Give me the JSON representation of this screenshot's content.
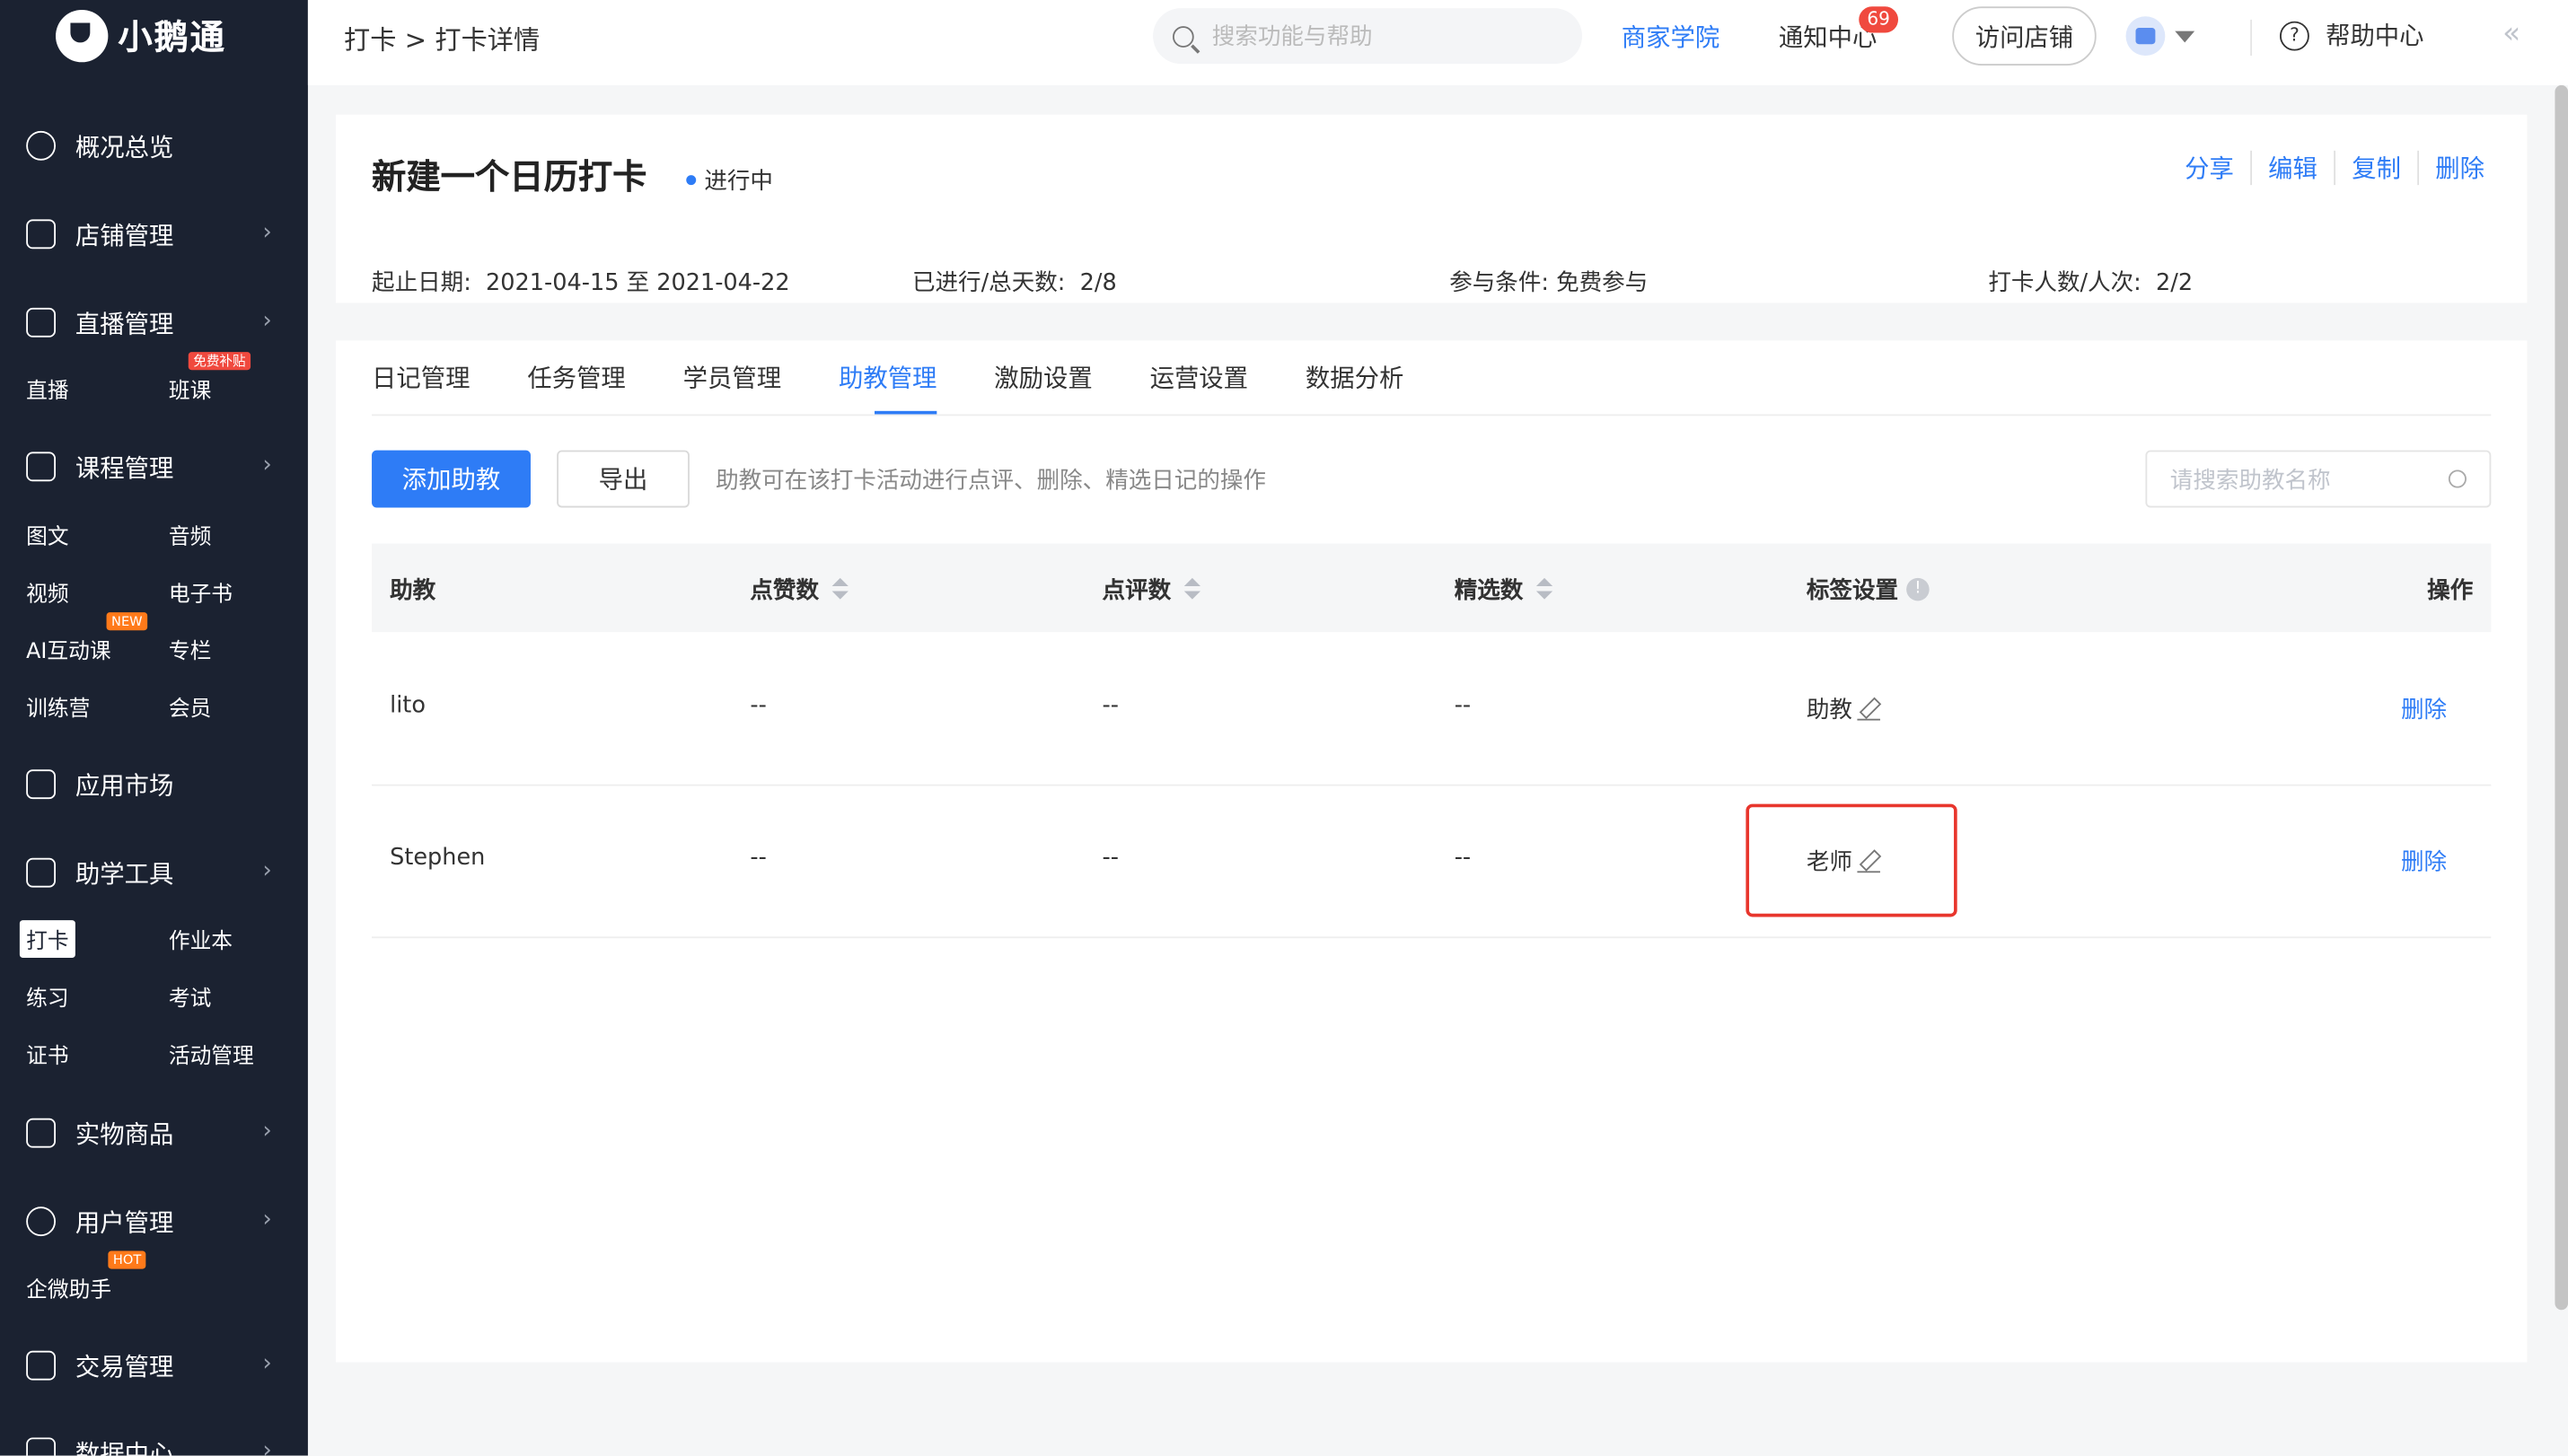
{
  "sidebar": {
    "logo": "小鹅通",
    "sections": {
      "overview": "概况总览",
      "store": "店铺管理",
      "live": "直播管理",
      "course": "课程管理",
      "market": "应用市场",
      "tools": "助学工具",
      "goods": "实物商品",
      "users": "用户管理",
      "trade": "交易管理",
      "data": "数据中心"
    },
    "live_items": [
      "直播",
      "班课"
    ],
    "course_items": [
      "图文",
      "音频",
      "视频",
      "电子书",
      "AI互动课",
      "专栏",
      "训练营",
      "会员"
    ],
    "tools_items": [
      "打卡",
      "作业本",
      "练习",
      "考试",
      "证书",
      "活动管理"
    ],
    "user_items": [
      "企微助手"
    ],
    "tags": {
      "free": "免费补贴",
      "new": "NEW",
      "hot": "HOT"
    }
  },
  "topbar": {
    "breadcrumb": "打卡 > 打卡详情",
    "search_placeholder": "搜索功能与帮助",
    "academy": "商家学院",
    "notice": "通知中心",
    "notice_count": "69",
    "visit_store": "访问店铺",
    "help": "帮助中心"
  },
  "activity": {
    "title": "新建一个日历打卡",
    "status": "进行中",
    "actions": [
      "分享",
      "编辑",
      "复制",
      "删除"
    ],
    "date_label": "起止日期:",
    "date_value": "2021-04-15 至 2021-04-22",
    "progress_label": "已进行/总天数:",
    "progress_value": "2/8",
    "condition_label": "参与条件:",
    "condition_value": "免费参与",
    "count_label": "打卡人数/人次:",
    "count_value": "2/2"
  },
  "tabs": [
    "日记管理",
    "任务管理",
    "学员管理",
    "助教管理",
    "激励设置",
    "运营设置",
    "数据分析"
  ],
  "active_tab": "助教管理",
  "toolbar": {
    "add": "添加助教",
    "export": "导出",
    "hint": "助教可在该打卡活动进行点评、删除、精选日记的操作",
    "search_placeholder": "请搜索助教名称"
  },
  "table": {
    "headers": {
      "name": "助教",
      "likes": "点赞数",
      "comments": "点评数",
      "picks": "精选数",
      "tag": "标签设置",
      "ops": "操作"
    },
    "rows": [
      {
        "name": "lito",
        "likes": "--",
        "comments": "--",
        "picks": "--",
        "tag": "助教",
        "op": "删除"
      },
      {
        "name": "Stephen",
        "likes": "--",
        "comments": "--",
        "picks": "--",
        "tag": "老师",
        "op": "删除"
      }
    ]
  },
  "colors": {
    "sidebar": "#1b2231",
    "primary": "#2e7cf6",
    "highlight": "#e8362d",
    "badge": "#f0493e"
  }
}
